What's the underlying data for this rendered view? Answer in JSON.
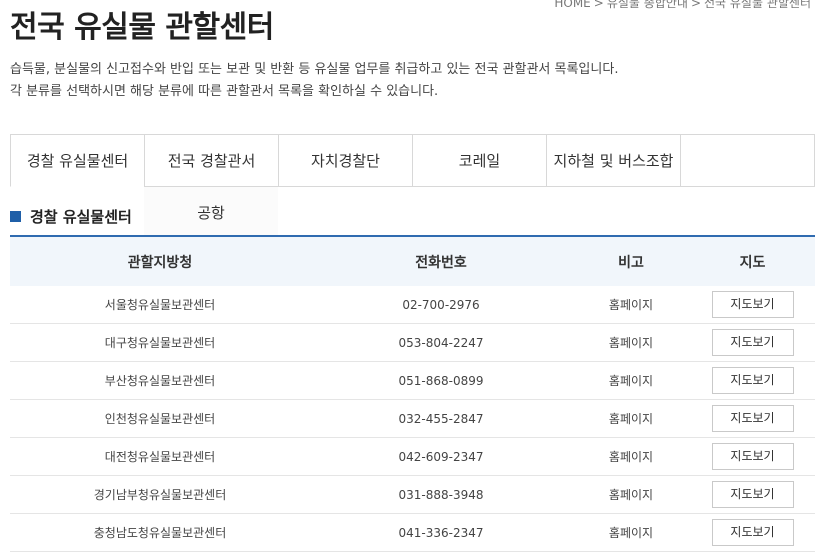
{
  "breadcrumb": [
    "HOME",
    "유실물 종합안내",
    "전국 유실물 관할센터"
  ],
  "page_title": "전국 유실물 관할센터",
  "description": [
    "습득물, 분실물의 신고접수와 반입 또는 보관 및 반환 등 유실물 업무를 취급하고 있는 전국 관할관서 목록입니다.",
    "각 분류를 선택하시면 해당 분류에 따른 관할관서 목록을 확인하실 수 있습니다."
  ],
  "tabs": [
    "경찰 유실물센터",
    "전국 경찰관서",
    "자치경찰단",
    "코레일",
    "지하철 및 버스조합",
    "공항"
  ],
  "section_heading": "경찰 유실물센터",
  "table": {
    "headers": [
      "관할지방청",
      "전화번호",
      "비고",
      "지도"
    ],
    "rows": [
      {
        "name": "서울청유실물보관센터",
        "phone": "02-700-2976",
        "note": "홈페이지",
        "map": "지도보기"
      },
      {
        "name": "대구청유실물보관센터",
        "phone": "053-804-2247",
        "note": "홈페이지",
        "map": "지도보기"
      },
      {
        "name": "부산청유실물보관센터",
        "phone": "051-868-0899",
        "note": "홈페이지",
        "map": "지도보기"
      },
      {
        "name": "인천청유실물보관센터",
        "phone": "032-455-2847",
        "note": "홈페이지",
        "map": "지도보기"
      },
      {
        "name": "대전청유실물보관센터",
        "phone": "042-609-2347",
        "note": "홈페이지",
        "map": "지도보기"
      },
      {
        "name": "경기남부청유실물보관센터",
        "phone": "031-888-3948",
        "note": "홈페이지",
        "map": "지도보기"
      },
      {
        "name": "충청남도청유실물보관센터",
        "phone": "041-336-2347",
        "note": "홈페이지",
        "map": "지도보기"
      }
    ]
  },
  "colors": {
    "accent": "#2f6bb0",
    "header_bg": "#f1f6fb",
    "heading_square": "#1f5fa8"
  }
}
